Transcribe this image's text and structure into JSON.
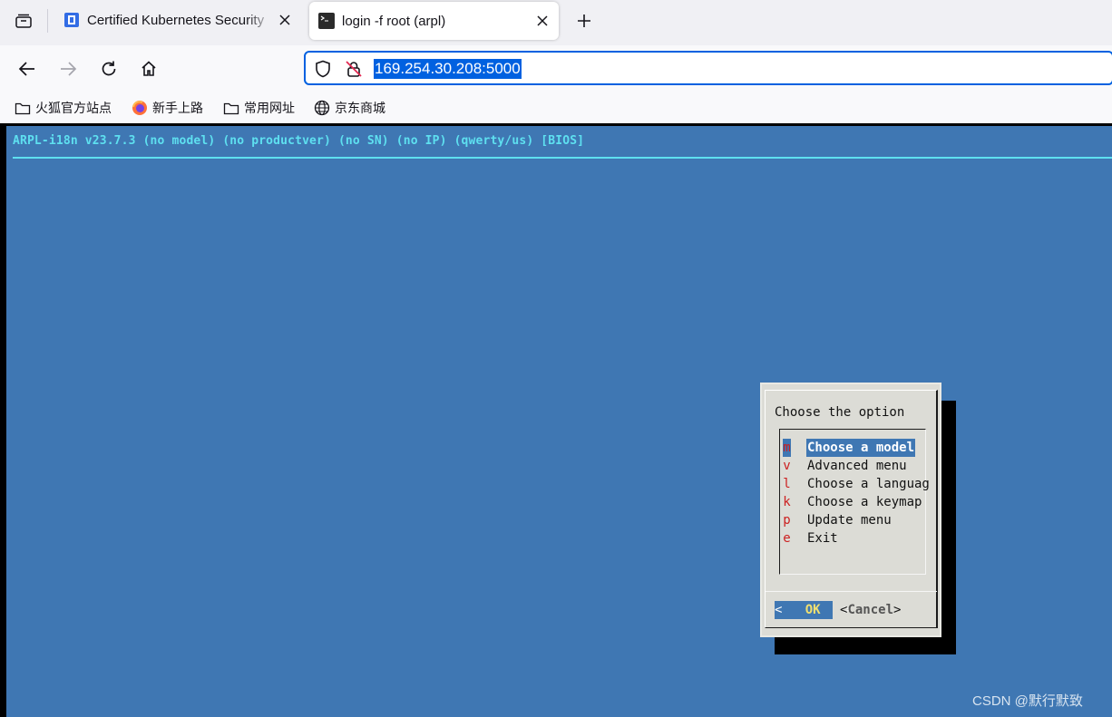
{
  "browser": {
    "tabs": [
      {
        "title": "Certified Kubernetes Security",
        "icon": "kubernetes-training-icon",
        "active": false
      },
      {
        "title": "login -f root (arpl)",
        "icon": "terminal-icon",
        "active": true
      }
    ],
    "url": "169.254.30.208:5000",
    "bookmarks": [
      {
        "label": "火狐官方站点",
        "icon": "folder-icon"
      },
      {
        "label": "新手上路",
        "icon": "firefox-icon"
      },
      {
        "label": "常用网址",
        "icon": "folder-icon"
      },
      {
        "label": "京东商城",
        "icon": "globe-icon"
      }
    ]
  },
  "terminal": {
    "header": "ARPL-i18n v23.7.3 (no model) (no productver) (no SN) (no IP) (qwerty/us) [BIOS]",
    "dialog": {
      "prompt": "Choose the option",
      "items": [
        {
          "key": "m",
          "label": "Choose a model",
          "selected": true
        },
        {
          "key": "v",
          "label": "Advanced menu",
          "selected": false
        },
        {
          "key": "l",
          "label": "Choose a languag",
          "selected": false
        },
        {
          "key": "k",
          "label": "Choose a keymap",
          "selected": false
        },
        {
          "key": "p",
          "label": "Update menu",
          "selected": false
        },
        {
          "key": "e",
          "label": "Exit",
          "selected": false
        }
      ],
      "ok": {
        "left": "<",
        "label": "OK",
        "right": ">"
      },
      "cancel": {
        "left": "<",
        "label": "Cancel",
        "right": ">"
      }
    }
  },
  "watermark": "CSDN @默行默致",
  "colors": {
    "terminal_bg": "#3f77b3",
    "header_text": "#5ee0f0",
    "dialog_bg": "#dcdcd6",
    "hotkey": "#cc2020",
    "url_highlight": "#0061e0"
  }
}
